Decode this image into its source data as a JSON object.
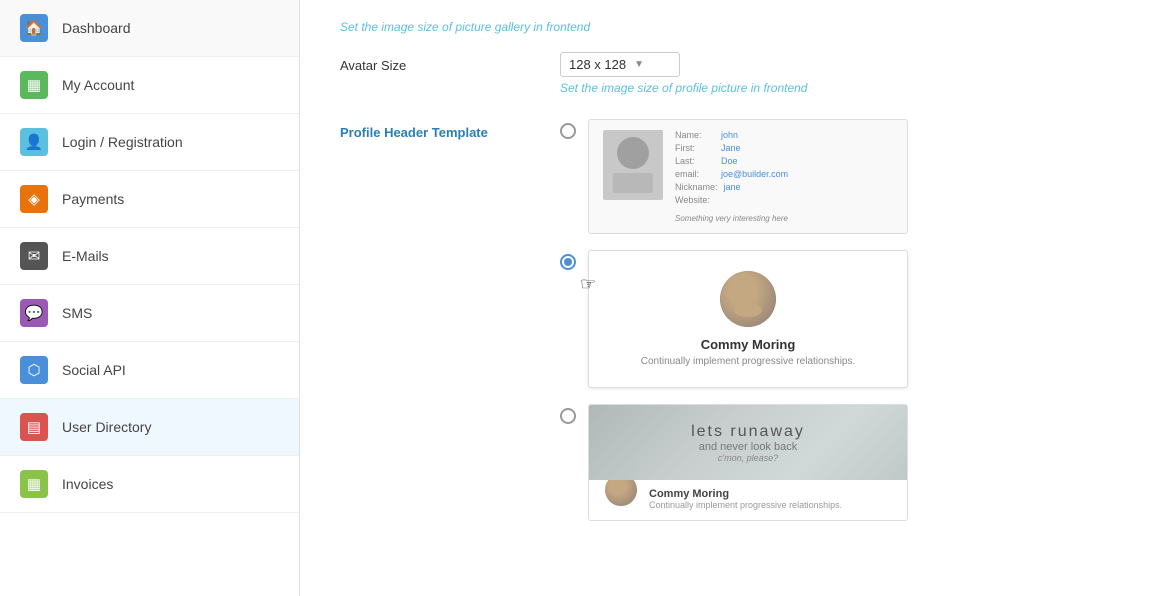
{
  "sidebar": {
    "items": [
      {
        "id": "dashboard",
        "label": "Dashboard",
        "icon": "🏠",
        "iconClass": "icon-blue"
      },
      {
        "id": "my-account",
        "label": "My Account",
        "icon": "▦",
        "iconClass": "icon-green"
      },
      {
        "id": "login-registration",
        "label": "Login / Registration",
        "icon": "👤",
        "iconClass": "icon-teal"
      },
      {
        "id": "payments",
        "label": "Payments",
        "icon": "◈",
        "iconClass": "icon-orange"
      },
      {
        "id": "emails",
        "label": "E-Mails",
        "icon": "✉",
        "iconClass": "icon-dark"
      },
      {
        "id": "sms",
        "label": "SMS",
        "icon": "💬",
        "iconClass": "icon-purple"
      },
      {
        "id": "social-api",
        "label": "Social API",
        "icon": "⬡",
        "iconClass": "icon-share"
      },
      {
        "id": "user-directory",
        "label": "User Directory",
        "icon": "▤",
        "iconClass": "icon-red",
        "active": true
      },
      {
        "id": "invoices",
        "label": "Invoices",
        "icon": "▦",
        "iconClass": "icon-lime"
      }
    ]
  },
  "main": {
    "gallery_hint": "Set the image size of picture gallery in frontend",
    "avatar_size_label": "Avatar Size",
    "avatar_size_value": "128 x 128",
    "avatar_hint": "Set the image size of profile picture in frontend",
    "profile_header_label": "Profile Header Template",
    "template_options": [
      {
        "id": "template-1",
        "selected": false,
        "preview_fields": [
          {
            "label": "Name:",
            "value": "john"
          },
          {
            "label": "First:",
            "value": "Jane"
          },
          {
            "label": "Last:",
            "value": "Doe"
          },
          {
            "label": "email:",
            "value": "joe@builder.com"
          },
          {
            "label": "Nickname:",
            "value": "jane"
          },
          {
            "label": "Website:",
            "value": ""
          }
        ],
        "bio": "Something very interesting here"
      },
      {
        "id": "template-2",
        "selected": true,
        "name": "Commy Moring",
        "bio": "Continually implement progressive relationships."
      },
      {
        "id": "template-3",
        "selected": false,
        "banner_text1": "lets runaway",
        "banner_text2": "and never look back",
        "banner_text3": "c'mon, please?",
        "name": "Commy Moring",
        "bio": "Continually implement progressive relationships."
      }
    ]
  }
}
